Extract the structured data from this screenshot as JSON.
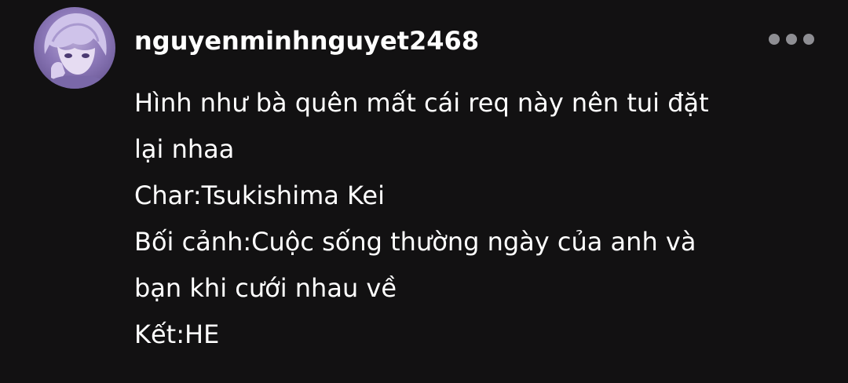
{
  "comment": {
    "username": "nguyenminhnguyet2468",
    "avatar_icon": "avatar-anime-portrait",
    "more_icon": "more-dots-icon",
    "lines": [
      "Hình như bà quên mất cái req này nên tui đặt",
      "lại nhaa",
      "Char:Tsukishima Kei",
      "Bối cảnh:Cuộc sống thường ngày của anh và",
      "bạn khi cưới nhau về",
      "Kết:HE"
    ]
  },
  "colors": {
    "background": "#121112",
    "text": "#ffffff",
    "icon": "#8e8e93"
  }
}
